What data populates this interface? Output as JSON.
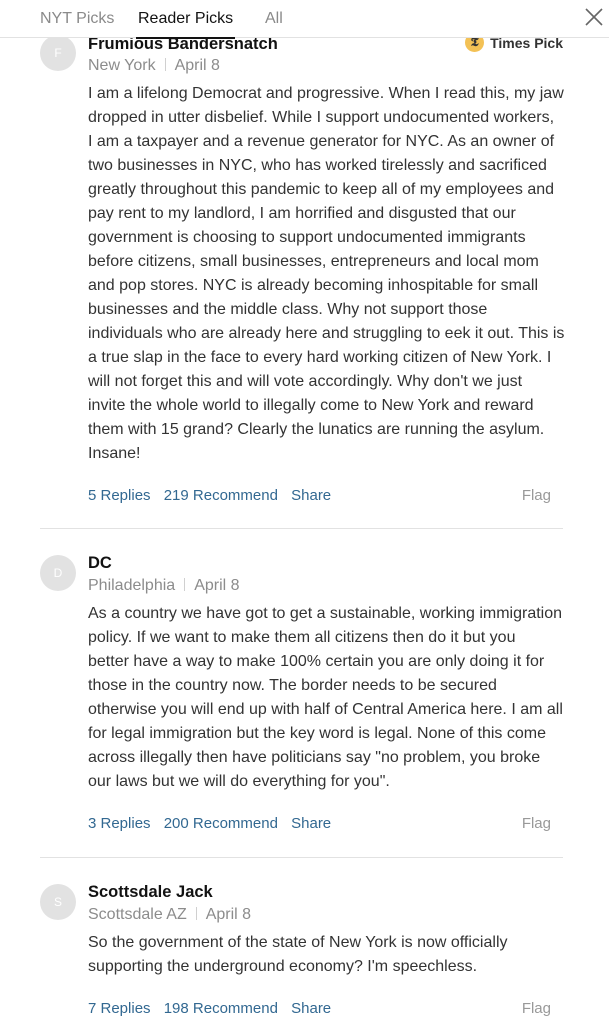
{
  "tabs": {
    "nyt": "NYT Picks",
    "reader": "Reader Picks",
    "all": "All"
  },
  "comments": [
    {
      "initial": "F",
      "name": "Frumious Bandersnatch",
      "location": "New York",
      "date": "April 8",
      "badge": "Times Pick",
      "lines": [
        "I am a lifelong Democrat and progressive. When I read this, my jaw",
        "dropped in utter disbelief. While I support undocumented workers,",
        "I am a taxpayer and a revenue generator for NYC. As an owner of",
        "two businesses in NYC, who has worked tirelessly and sacrificed",
        "greatly throughout  this pandemic to keep all of my employees and",
        "pay rent to my landlord, I am horrified and disgusted that our",
        "government is choosing to support undocumented immigrants",
        "before citizens, small businesses, entrepreneurs and local mom",
        "and pop stores. NYC is already becoming inhospitable for small",
        "businesses and the middle class. Why not support those",
        "individuals who are already here and struggling to eek it out. This is",
        "a true slap in the face to every hard working citizen of New York. I",
        "will not forget this and will vote accordingly. Why don't we just",
        "invite the whole world to illegally come to New York and reward",
        "them with 15 grand? Clearly the lunatics are running the asylum.",
        "Insane!"
      ],
      "replies": "5 Replies",
      "recommend": "219 Recommend",
      "share": "Share",
      "flag": "Flag"
    },
    {
      "initial": "D",
      "name": "DC",
      "location": "Philadelphia",
      "date": "April 8",
      "lines": [
        "As a country we have got to get a sustainable, working immigration",
        "policy. If we want to make them all citizens then do it but you",
        "better have a way to make 100% certain you are only doing it for",
        "those in the country now. The border needs to be secured",
        "otherwise you will end up with half of Central America here. I am all",
        "for legal immigration but the key word is legal. None of this come",
        "across illegally then have politicians say \"no problem, you broke",
        "our laws but we will do everything for you\"."
      ],
      "replies": "3 Replies",
      "recommend": "200 Recommend",
      "share": "Share",
      "flag": "Flag"
    },
    {
      "initial": "S",
      "name": "Scottsdale Jack",
      "location": "Scottsdale AZ",
      "date": "April 8",
      "lines": [
        "So the government of the state of New York is now officially",
        "supporting the underground economy? I'm speechless."
      ],
      "replies": "7 Replies",
      "recommend": "198 Recommend",
      "share": "Share",
      "flag": "Flag"
    }
  ]
}
